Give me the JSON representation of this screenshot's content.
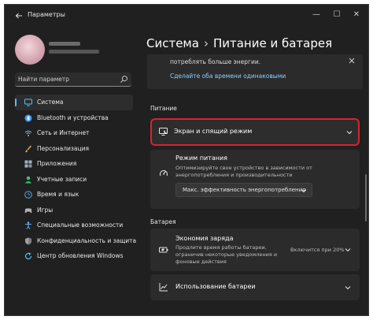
{
  "window": {
    "title": "Параметры",
    "back_icon": "arrow-left-icon",
    "controls": {
      "minimize": "—",
      "maximize": "☐",
      "close": "✕"
    }
  },
  "sidebar": {
    "search": {
      "placeholder": "Найти параметр",
      "icon": "search-icon"
    },
    "items": [
      {
        "label": "Система",
        "icon": "monitor-icon",
        "active": true,
        "color": "#4cc2ff"
      },
      {
        "label": "Bluetooth и устройства",
        "icon": "bluetooth-icon",
        "color": "#3b9cff"
      },
      {
        "label": "Сеть и Интернет",
        "icon": "wifi-icon",
        "color": "#8fb2d6"
      },
      {
        "label": "Персонализация",
        "icon": "brush-icon",
        "color": "#e5a563"
      },
      {
        "label": "Приложения",
        "icon": "apps-icon",
        "color": "#9fb4c8"
      },
      {
        "label": "Учетные записи",
        "icon": "user-icon",
        "color": "#35c46a"
      },
      {
        "label": "Время и язык",
        "icon": "globe-clock-icon",
        "color": "#4fa8e8"
      },
      {
        "label": "Игры",
        "icon": "gamepad-icon",
        "color": "#b3b3b3"
      },
      {
        "label": "Специальные возможности",
        "icon": "accessibility-icon",
        "color": "#5aa9f0"
      },
      {
        "label": "Конфиденциальность и защита",
        "icon": "shield-icon",
        "color": "#a0a0a0"
      },
      {
        "label": "Центр обновления Windows",
        "icon": "update-icon",
        "color": "#4cc2ff"
      }
    ]
  },
  "main": {
    "breadcrumb": {
      "parent": "Система",
      "separator": "›",
      "current": "Питание и батарея"
    },
    "top_card": {
      "text": "потреблять больше энергии.",
      "link": "Сделайте оба времени одинаковыми"
    },
    "power_section": {
      "label": "Питание",
      "screen_sleep": {
        "label": "Экран и спящий режим",
        "icon": "screen-sleep-icon"
      },
      "power_mode": {
        "title": "Режим питания",
        "description": "Оптимизируйте свое устройство в зависимости от энергопотребления и производительности",
        "selected": "Макс. эффективность энергопотребления",
        "icon": "power-mode-icon"
      }
    },
    "battery_section": {
      "label": "Батарея",
      "saver": {
        "title": "Экономия заряда",
        "description": "Продлите время работы батареи, ограничив некоторые уведомления и фоновые действия",
        "status": "Включится при 20%",
        "icon": "battery-saver-icon"
      },
      "usage": {
        "label": "Использование батареи",
        "icon": "chart-icon"
      }
    }
  }
}
